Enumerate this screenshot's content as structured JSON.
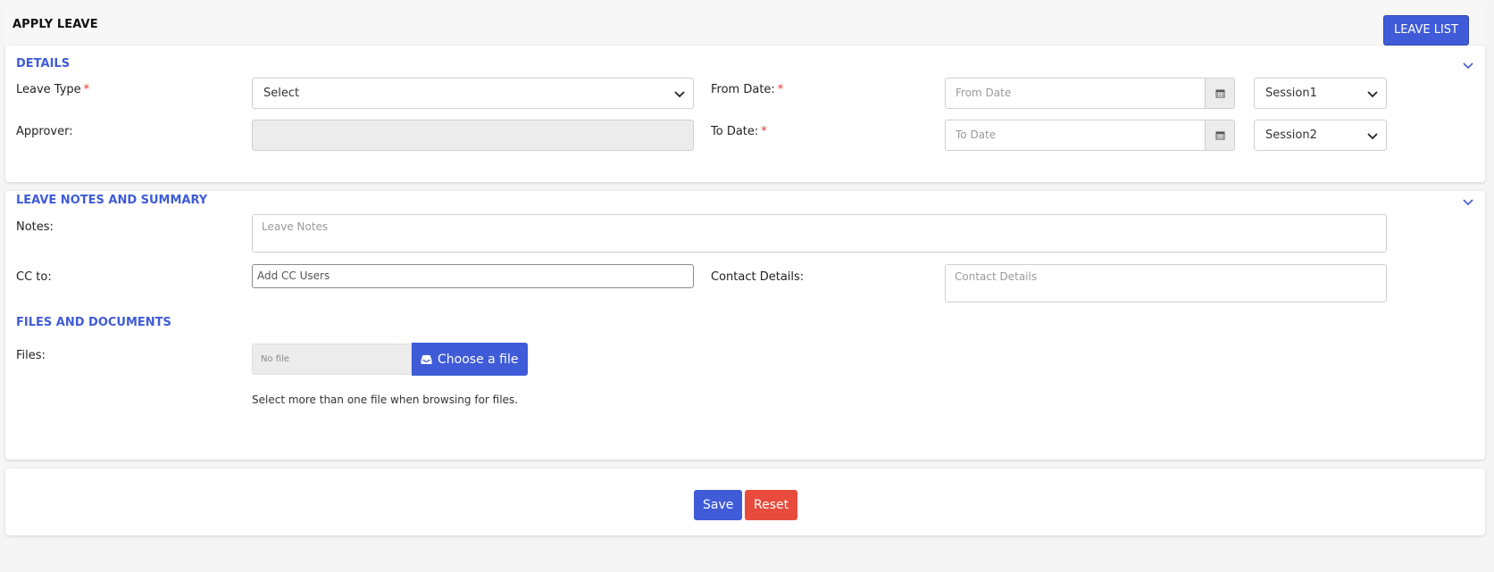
{
  "header": {
    "title": "APPLY LEAVE",
    "leave_list_label": "LEAVE LIST"
  },
  "details": {
    "section_title": "DETAILS",
    "leave_type_label": "Leave Type",
    "leave_type_value": "Select",
    "approver_label": "Approver:",
    "approver_value": "",
    "from_date_label": "From Date:",
    "from_date_placeholder": "From Date",
    "from_session_value": "Session1",
    "to_date_label": "To Date:",
    "to_date_placeholder": "To Date",
    "to_session_value": "Session2",
    "required_mark": "*"
  },
  "notes_section": {
    "section_title": "LEAVE NOTES AND SUMMARY",
    "notes_label": "Notes:",
    "notes_placeholder": "Leave Notes",
    "cc_label": "CC to:",
    "cc_placeholder": "Add CC Users",
    "contact_label": "Contact Details:",
    "contact_placeholder": "Contact Details"
  },
  "files_section": {
    "section_title": "FILES AND DOCUMENTS",
    "files_label": "Files:",
    "file_name_value": "No file",
    "choose_file_label": "Choose a file",
    "hint": "Select more than one file when browsing for files."
  },
  "actions": {
    "save_label": "Save",
    "reset_label": "Reset"
  },
  "colors": {
    "accent": "#3f5bd8",
    "danger": "#e84b3c",
    "required": "#e0342f"
  },
  "icons": [
    "chevron-down-icon",
    "calendar-icon",
    "inbox-icon"
  ]
}
